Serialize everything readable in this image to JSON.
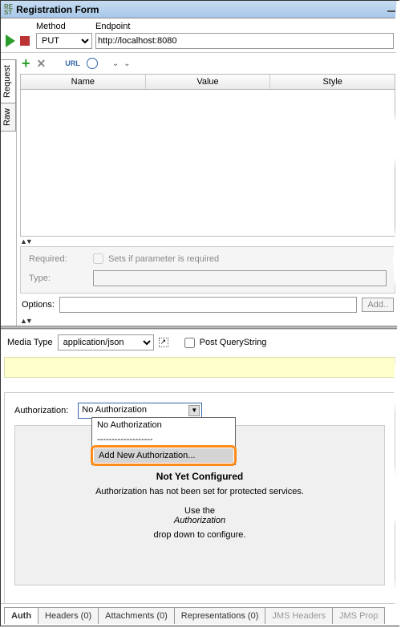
{
  "title": "Registration Form",
  "method": {
    "label": "Method",
    "value": "PUT"
  },
  "endpoint": {
    "label": "Endpoint",
    "value": "http://localhost:8080"
  },
  "side_tabs": {
    "request": "Request",
    "raw": "Raw"
  },
  "columns": {
    "name": "Name",
    "value": "Value",
    "style": "Style"
  },
  "required": {
    "label": "Required:",
    "checkbox_label": "Sets if parameter is required"
  },
  "type_label": "Type:",
  "options": {
    "label": "Options:",
    "add": "Add.."
  },
  "media": {
    "label": "Media Type",
    "value": "application/json",
    "post_qs": "Post QueryString"
  },
  "auth": {
    "label": "Authorization:",
    "selected": "No Authorization",
    "options": [
      "No Authorization",
      "-------------------",
      "Add New Authorization..."
    ],
    "not_configured_title": "Not Yet Configured",
    "not_configured_msg1": "Authorization has not been set for protected services.",
    "not_configured_msg2_a": "Use the ",
    "not_configured_msg2_em": "Authorization",
    "not_configured_msg2_b": " drop down to configure."
  },
  "bottom_tabs": {
    "auth": "Auth",
    "headers": "Headers (0)",
    "attachments": "Attachments (0)",
    "representations": "Representations (0)",
    "jms_headers": "JMS Headers",
    "jms_prop": "JMS Prop"
  }
}
